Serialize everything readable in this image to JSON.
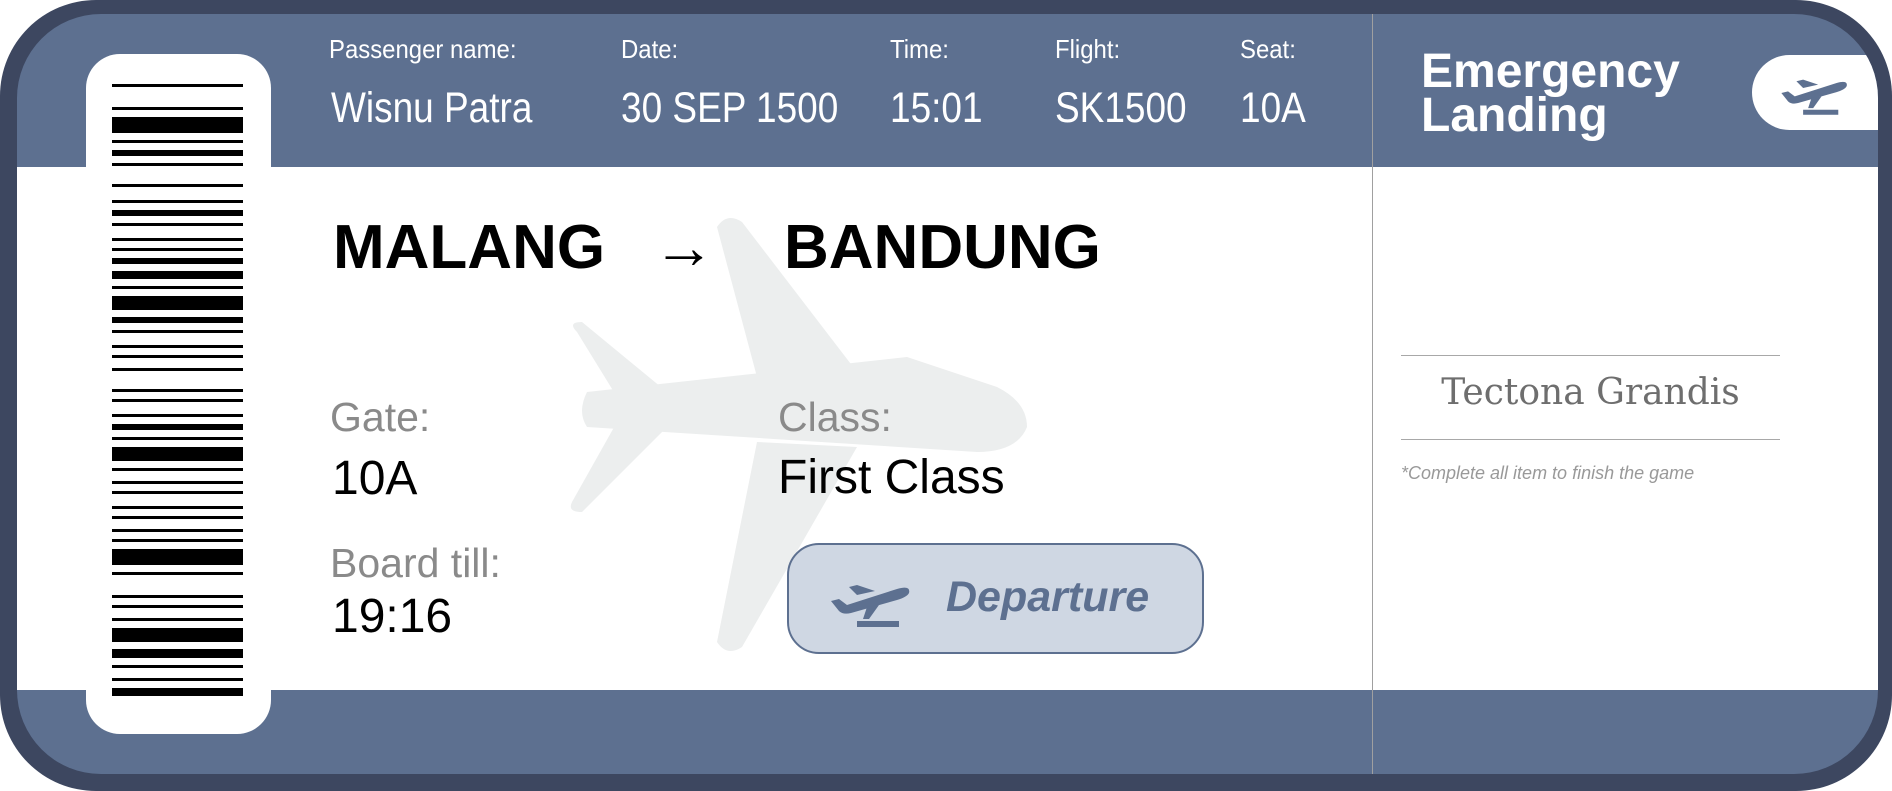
{
  "header": {
    "passenger_label": "Passenger name:",
    "passenger_value": "Wisnu Patra",
    "date_label": "Date:",
    "date_value": "30 SEP 1500",
    "time_label": "Time:",
    "time_value": "15:01",
    "flight_label": "Flight:",
    "flight_value": "SK1500",
    "seat_label": "Seat:",
    "seat_value": "10A"
  },
  "route": {
    "from": "MALANG",
    "arrow": "→",
    "to": "BANDUNG"
  },
  "details": {
    "gate_label": "Gate:",
    "gate_value": "10A",
    "board_label": "Board till:",
    "board_value": "19:16",
    "class_label": "Class:",
    "class_value": "First Class"
  },
  "departure_button": {
    "label": "Departure",
    "icon": "airplane-takeoff-icon"
  },
  "stub": {
    "title_line1": "Emergency",
    "title_line2": "Landing",
    "icon": "airplane-takeoff-icon",
    "signature": "Tectona Grandis",
    "note": "*Complete all item to finish the game"
  },
  "colors": {
    "border": "#3d4760",
    "band": "#5d7090",
    "button_bg": "#cfd7e3",
    "watermark": "#eceeee"
  }
}
